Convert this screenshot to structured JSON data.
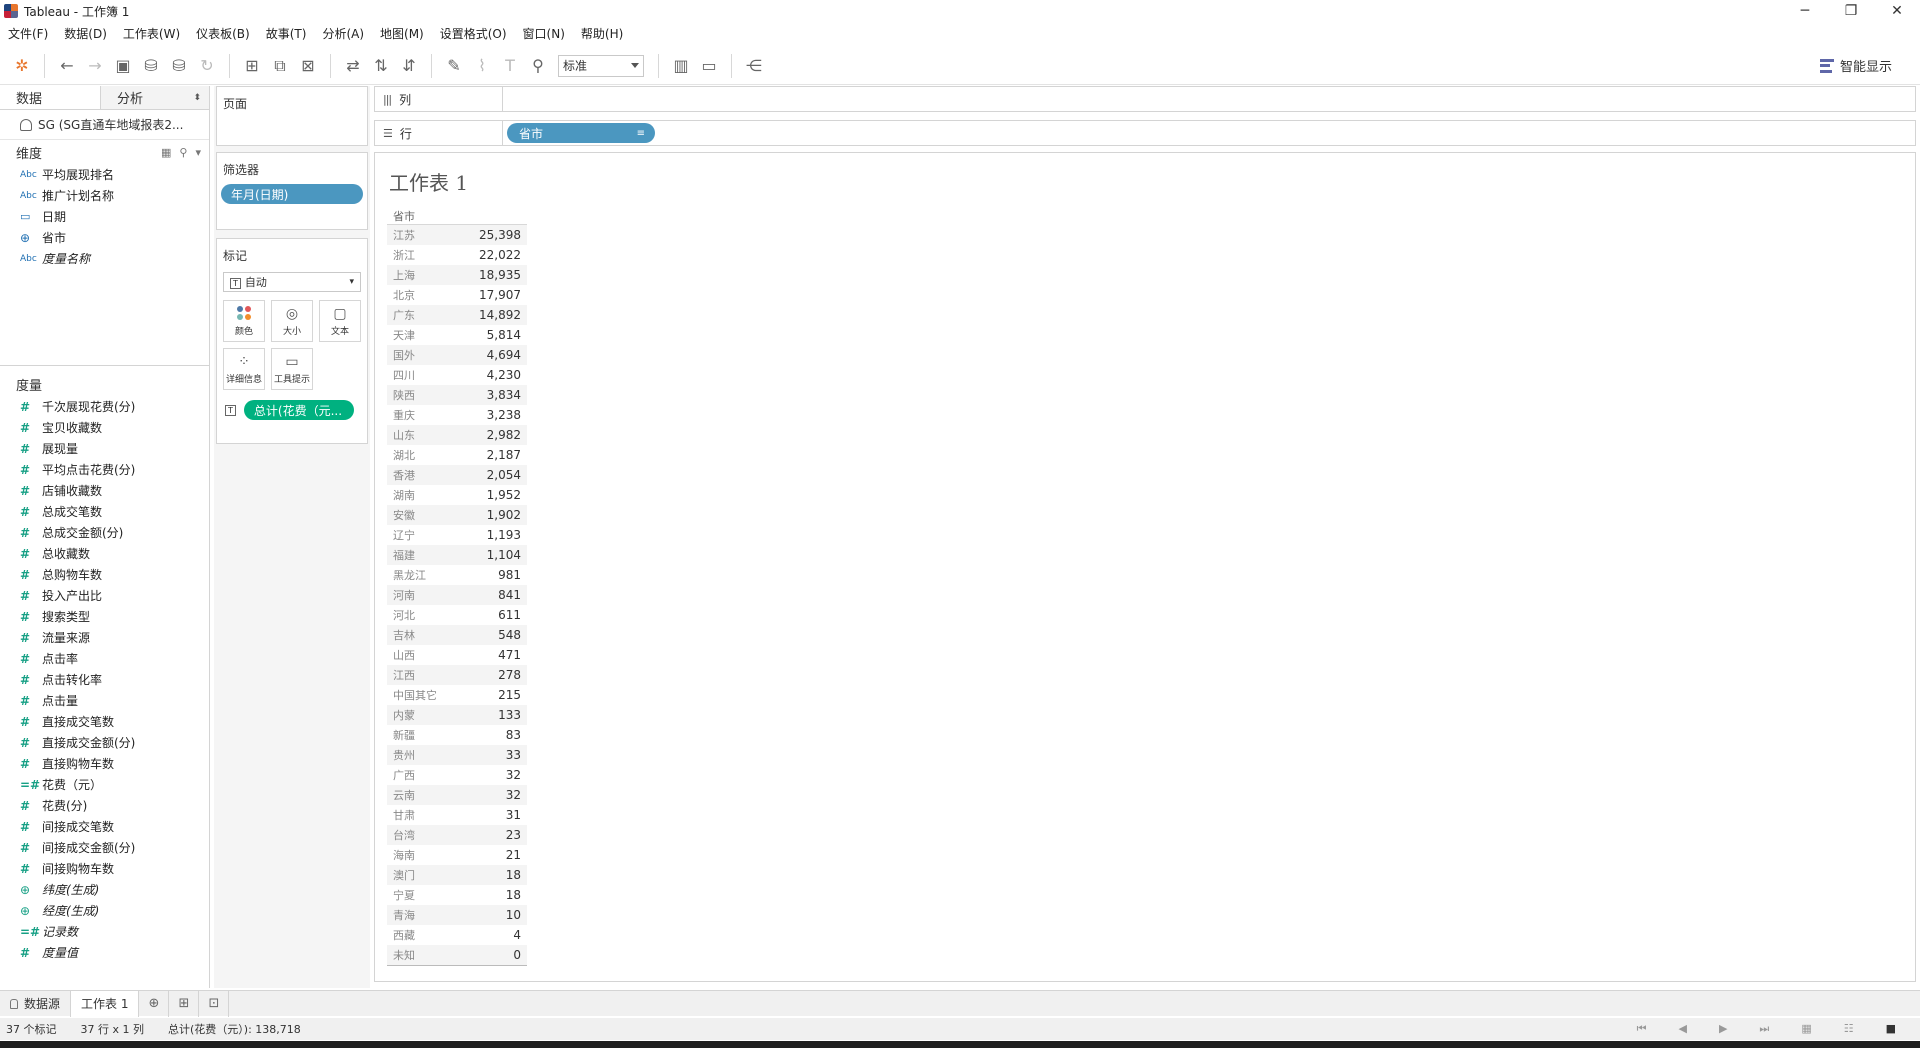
{
  "window": {
    "title": "Tableau - 工作簿 1",
    "minimize": "─",
    "restore": "❐",
    "close": "✕"
  },
  "menu": [
    "文件(F)",
    "数据(D)",
    "工作表(W)",
    "仪表板(B)",
    "故事(T)",
    "分析(A)",
    "地图(M)",
    "设置格式(O)",
    "窗口(N)",
    "帮助(H)"
  ],
  "toolbar": {
    "fit_select": "标准",
    "show_me": "智能显示"
  },
  "data_pane": {
    "tabs": [
      "数据",
      "分析"
    ],
    "datasource": "SG (SG直通车地域报表2...",
    "dimensions_title": "维度",
    "dimensions": [
      {
        "label": "平均展现排名",
        "icon": "Abc",
        "italic": false
      },
      {
        "label": "推广计划名称",
        "icon": "Abc",
        "italic": false
      },
      {
        "label": "日期",
        "icon": "▭",
        "italic": false
      },
      {
        "label": "省市",
        "icon": "⊕",
        "italic": false
      },
      {
        "label": "度量名称",
        "icon": "Abc",
        "italic": true
      }
    ],
    "measures_title": "度量",
    "measures": [
      {
        "label": "千次展现花费(分)",
        "icon": "#",
        "italic": false
      },
      {
        "label": "宝贝收藏数",
        "icon": "#",
        "italic": false
      },
      {
        "label": "展现量",
        "icon": "#",
        "italic": false
      },
      {
        "label": "平均点击花费(分)",
        "icon": "#",
        "italic": false
      },
      {
        "label": "店铺收藏数",
        "icon": "#",
        "italic": false
      },
      {
        "label": "总成交笔数",
        "icon": "#",
        "italic": false
      },
      {
        "label": "总成交金额(分)",
        "icon": "#",
        "italic": false
      },
      {
        "label": "总收藏数",
        "icon": "#",
        "italic": false
      },
      {
        "label": "总购物车数",
        "icon": "#",
        "italic": false
      },
      {
        "label": "投入产出比",
        "icon": "#",
        "italic": false
      },
      {
        "label": "搜索类型",
        "icon": "#",
        "italic": false
      },
      {
        "label": "流量来源",
        "icon": "#",
        "italic": false
      },
      {
        "label": "点击率",
        "icon": "#",
        "italic": false
      },
      {
        "label": "点击转化率",
        "icon": "#",
        "italic": false
      },
      {
        "label": "点击量",
        "icon": "#",
        "italic": false
      },
      {
        "label": "直接成交笔数",
        "icon": "#",
        "italic": false
      },
      {
        "label": "直接成交金额(分)",
        "icon": "#",
        "italic": false
      },
      {
        "label": "直接购物车数",
        "icon": "#",
        "italic": false
      },
      {
        "label": "花费（元）",
        "icon": "=#",
        "italic": false
      },
      {
        "label": "花费(分)",
        "icon": "#",
        "italic": false
      },
      {
        "label": "间接成交笔数",
        "icon": "#",
        "italic": false
      },
      {
        "label": "间接成交金额(分)",
        "icon": "#",
        "italic": false
      },
      {
        "label": "间接购物车数",
        "icon": "#",
        "italic": false
      },
      {
        "label": "纬度(生成)",
        "icon": "⊕",
        "italic": true
      },
      {
        "label": "经度(生成)",
        "icon": "⊕",
        "italic": true
      },
      {
        "label": "记录数",
        "icon": "=#",
        "italic": true
      },
      {
        "label": "度量值",
        "icon": "#",
        "italic": true
      }
    ]
  },
  "cards": {
    "pages_title": "页面",
    "filters_title": "筛选器",
    "filter_pill": "年月(日期)",
    "marks_title": "标记",
    "marks_type": "自动",
    "mark_buttons": [
      "颜色",
      "大小",
      "文本",
      "详细信息",
      "工具提示"
    ],
    "marks_pill": "总计(花费（元..."
  },
  "shelves": {
    "columns_label": "列",
    "rows_label": "行",
    "rows_pill": "省市"
  },
  "view": {
    "title": "工作表 1",
    "header": "省市",
    "rows": [
      [
        "江苏",
        "25,398"
      ],
      [
        "浙江",
        "22,022"
      ],
      [
        "上海",
        "18,935"
      ],
      [
        "北京",
        "17,907"
      ],
      [
        "广东",
        "14,892"
      ],
      [
        "天津",
        "5,814"
      ],
      [
        "国外",
        "4,694"
      ],
      [
        "四川",
        "4,230"
      ],
      [
        "陕西",
        "3,834"
      ],
      [
        "重庆",
        "3,238"
      ],
      [
        "山东",
        "2,982"
      ],
      [
        "湖北",
        "2,187"
      ],
      [
        "香港",
        "2,054"
      ],
      [
        "湖南",
        "1,952"
      ],
      [
        "安徽",
        "1,902"
      ],
      [
        "辽宁",
        "1,193"
      ],
      [
        "福建",
        "1,104"
      ],
      [
        "黑龙江",
        "981"
      ],
      [
        "河南",
        "841"
      ],
      [
        "河北",
        "611"
      ],
      [
        "吉林",
        "548"
      ],
      [
        "山西",
        "471"
      ],
      [
        "江西",
        "278"
      ],
      [
        "中国其它",
        "215"
      ],
      [
        "内蒙",
        "133"
      ],
      [
        "新疆",
        "83"
      ],
      [
        "贵州",
        "33"
      ],
      [
        "广西",
        "32"
      ],
      [
        "云南",
        "32"
      ],
      [
        "甘肃",
        "31"
      ],
      [
        "台湾",
        "23"
      ],
      [
        "海南",
        "21"
      ],
      [
        "澳门",
        "18"
      ],
      [
        "宁夏",
        "18"
      ],
      [
        "青海",
        "10"
      ],
      [
        "西藏",
        "4"
      ],
      [
        "未知",
        "0"
      ]
    ]
  },
  "sheet_tabs": {
    "datasource": "数据源",
    "active": "工作表 1"
  },
  "status": {
    "marks": "37 个标记",
    "dims": "37 行 x 1 列",
    "sum": "总计(花费（元）): 138,718"
  }
}
